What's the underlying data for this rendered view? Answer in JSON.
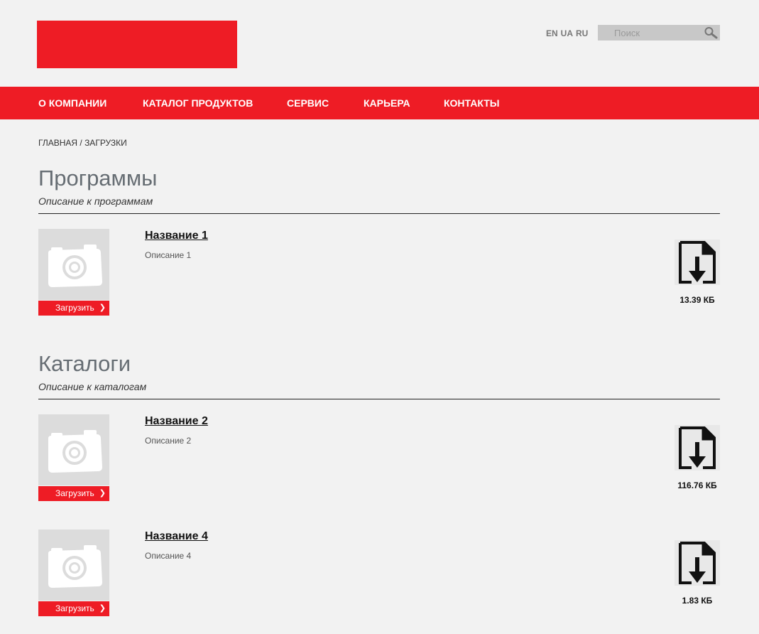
{
  "header": {
    "languages": [
      "EN",
      "UA",
      "RU"
    ],
    "search_placeholder": "Поиск"
  },
  "nav": {
    "items": [
      "О КОМПАНИИ",
      "КАТАЛОГ ПРОДУКТОВ",
      "СЕРВИС",
      "КАРЬЕРА",
      "КОНТАКТЫ"
    ]
  },
  "breadcrumb": {
    "home": "ГЛАВНАЯ",
    "separator": " / ",
    "current": "ЗАГРУЗКИ"
  },
  "sections": [
    {
      "title": "Программы",
      "description": "Описание к программам",
      "items": [
        {
          "title": "Название 1",
          "description": "Описание 1",
          "button": "Загрузить",
          "size": "13.39 КБ"
        }
      ]
    },
    {
      "title": "Каталоги",
      "description": "Описание к каталогам",
      "items": [
        {
          "title": "Название 2",
          "description": "Описание 2",
          "button": "Загрузить",
          "size": "116.76 КБ"
        },
        {
          "title": "Название 4",
          "description": "Описание 4",
          "button": "Загрузить",
          "size": "1.83 КБ"
        }
      ]
    }
  ],
  "colors": {
    "brand_red": "#ee1c25",
    "background": "#f2f2f2",
    "title_gray": "#666d73"
  },
  "icons": {
    "search": "magnifier-icon",
    "thumbnail": "camera-icon",
    "file": "file-download-icon"
  }
}
